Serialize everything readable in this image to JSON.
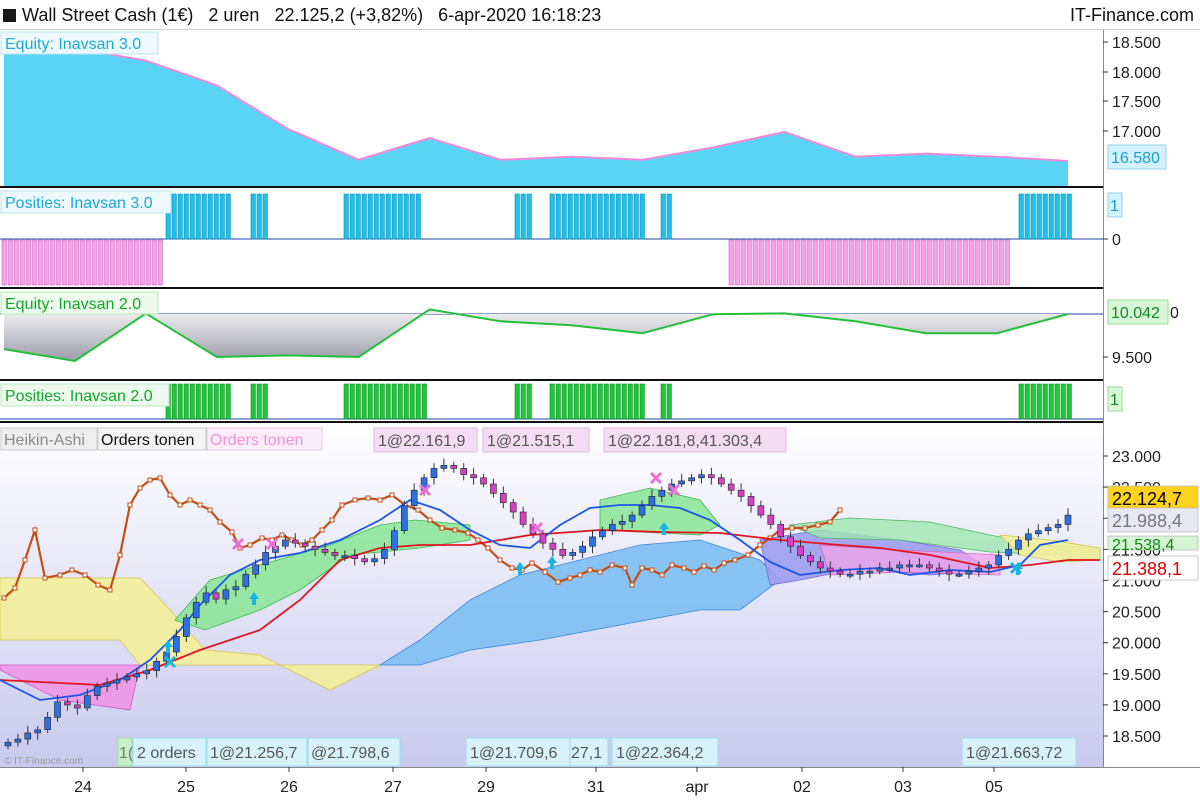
{
  "header": {
    "instrument": "Wall Street Cash (1€)",
    "timeframe": "2 uren",
    "price": "22.125,2",
    "change": "(+3,82%)",
    "datetime": "6-apr-2020 16:18:23",
    "brand": "IT-Finance.com"
  },
  "panels": {
    "equity3": {
      "title": "Equity: Inavsan 3.0",
      "value_tag": "16.580",
      "color": "#59d4f4",
      "line": "#f08ad8"
    },
    "pos3": {
      "title": "Posities: Inavsan 3.0",
      "value_tag": "1",
      "color": "#1fc1e8",
      "neg_color": "#f4a3ea"
    },
    "equity2": {
      "title": "Equity: Inavsan 2.0",
      "value_tag": "10.042",
      "color": "#22c03a"
    },
    "pos2": {
      "title": "Posities: Inavsan 2.0",
      "value_tag": "1",
      "color": "#1dc63a"
    },
    "main": {
      "tabs": [
        "Heikin-Ashi",
        "Orders tonen",
        "Orders tonen"
      ],
      "top_order_labels": [
        "1@22.161,9",
        "1@21.515,1",
        "1@22.181,8,41.303,4"
      ],
      "bottom_order_labels": [
        "1(",
        "2 orders",
        "1@21.256,7",
        "@21.798,6",
        "1@21.709,6",
        "27,1",
        "1@22.364,2",
        "1@21.663,72"
      ],
      "price_tags": [
        {
          "label": "22.124,7",
          "bg": "#ffd21f",
          "color": "#000000"
        },
        {
          "label": "21.988,4",
          "bg": "#e8e8f5",
          "color": "#777777"
        },
        {
          "label": "21.538,4",
          "bg": "#d4f4d4",
          "color": "#118811"
        },
        {
          "label": "21.388,1",
          "bg": "#ffffff",
          "color": "#dd0000"
        }
      ],
      "copyright": "© IT-Finance.com"
    }
  },
  "axes": {
    "equity3_ticks": [
      "18.500",
      "18.000",
      "17.500",
      "17.000"
    ],
    "pos3_ticks": [
      "0"
    ],
    "equity2_ticks": [
      "9.500"
    ],
    "equity2_right_fragment": "0",
    "main_ticks": [
      "23.000",
      "22.500",
      "22.000",
      "21.500",
      "21.000",
      "20.500",
      "20.000",
      "19.500",
      "19.000",
      "18.500"
    ],
    "dates": [
      "24",
      "25",
      "26",
      "27",
      "29",
      "31",
      "apr",
      "02",
      "03",
      "05"
    ]
  },
  "chart_data": {
    "type": "candlestick",
    "title": "Wall Street Cash (1€) — 2 uren",
    "ylim": [
      18250,
      23250
    ],
    "ohlc_close": [
      18400,
      18450,
      18550,
      18600,
      18800,
      19050,
      19000,
      18950,
      19150,
      19300,
      19350,
      19400,
      19450,
      19500,
      19550,
      19700,
      19850,
      20100,
      20400,
      20650,
      20800,
      20700,
      20850,
      20900,
      21100,
      21250,
      21450,
      21550,
      21650,
      21600,
      21550,
      21500,
      21450,
      21400,
      21400,
      21350,
      21300,
      21350,
      21500,
      21800,
      22200,
      22450,
      22650,
      22800,
      22850,
      22800,
      22700,
      22650,
      22550,
      22400,
      22250,
      22100,
      21900,
      21750,
      21600,
      21500,
      21400,
      21450,
      21550,
      21700,
      21800,
      21900,
      21950,
      22050,
      22200,
      22350,
      22450,
      22550,
      22600,
      22650,
      22700,
      22650,
      22550,
      22450,
      22350,
      22200,
      22050,
      21900,
      21700,
      21550,
      21400,
      21300,
      21200,
      21150,
      21100,
      21100,
      21150,
      21150,
      21200,
      21200,
      21250,
      21250,
      21250,
      21200,
      21150,
      21100,
      21100,
      21150,
      21200,
      21250,
      21400,
      21500,
      21650,
      21750,
      21800,
      21850,
      21900,
      22050
    ],
    "series": [
      {
        "name": "Equity: Inavsan 3.0",
        "values": [
          18500,
          18400,
          18200,
          17800,
          17100,
          16600,
          16950,
          16600,
          16650,
          16600,
          16800,
          17050,
          16650,
          16700,
          16650,
          16580
        ]
      },
      {
        "name": "Equity: Inavsan 2.0",
        "values": [
          9600,
          9450,
          10050,
          9500,
          9520,
          9500,
          10100,
          9950,
          9900,
          9800,
          10040,
          10050,
          9950,
          9800,
          9800,
          10042
        ]
      }
    ]
  }
}
